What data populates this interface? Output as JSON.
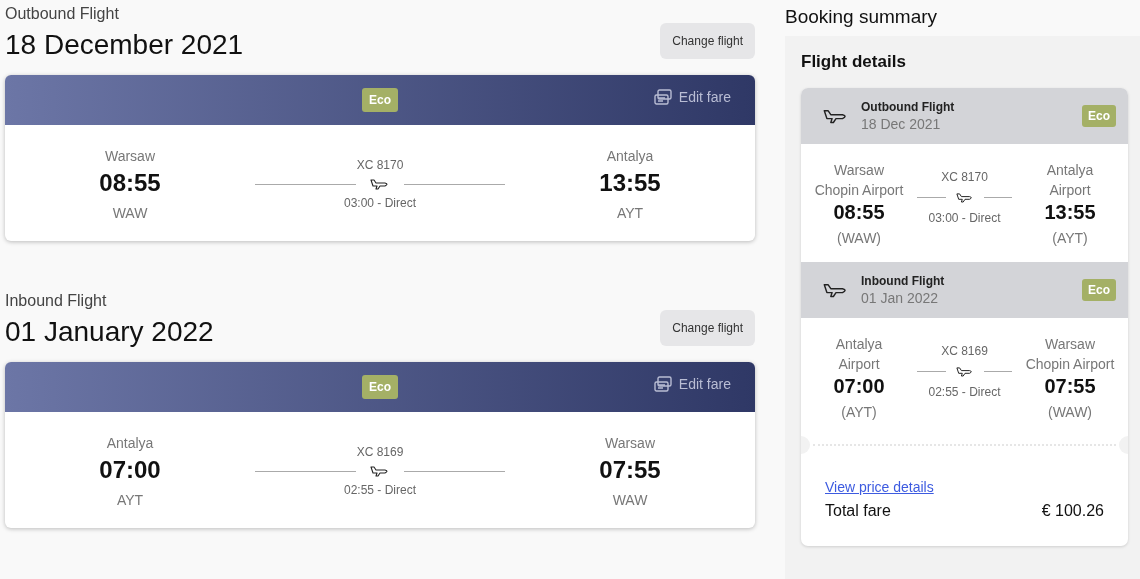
{
  "flights": [
    {
      "label": "Outbound Flight",
      "date": "18 December 2021",
      "change_button": "Change flight",
      "fare_badge": "Eco",
      "edit_fare": "Edit fare",
      "origin": {
        "city": "Warsaw",
        "time": "08:55",
        "code": "WAW"
      },
      "flight_number": "XC 8170",
      "duration": "03:00 - Direct",
      "destination": {
        "city": "Antalya",
        "time": "13:55",
        "code": "AYT"
      }
    },
    {
      "label": "Inbound Flight",
      "date": "01 January 2022",
      "change_button": "Change flight",
      "fare_badge": "Eco",
      "edit_fare": "Edit fare",
      "origin": {
        "city": "Antalya",
        "time": "07:00",
        "code": "AYT"
      },
      "flight_number": "XC 8169",
      "duration": "02:55 - Direct",
      "destination": {
        "city": "Warsaw",
        "time": "07:55",
        "code": "WAW"
      }
    }
  ],
  "summary": {
    "title": "Booking summary",
    "heading": "Flight details",
    "legs": [
      {
        "label": "Outbound Flight",
        "date": "18 Dec 2021",
        "badge": "Eco",
        "origin": {
          "airport": [
            "Warsaw",
            "Chopin Airport"
          ],
          "time": "08:55",
          "code": "(WAW)"
        },
        "flight_number": "XC 8170",
        "duration": "03:00 - Direct",
        "destination": {
          "airport": [
            "Antalya",
            "Airport"
          ],
          "time": "13:55",
          "code": "(AYT)"
        }
      },
      {
        "label": "Inbound Flight",
        "date": "01 Jan 2022",
        "badge": "Eco",
        "origin": {
          "airport": [
            "Antalya",
            "Airport"
          ],
          "time": "07:00",
          "code": "(AYT)"
        },
        "flight_number": "XC 8169",
        "duration": "02:55 - Direct",
        "destination": {
          "airport": [
            "Warsaw",
            "Chopin Airport"
          ],
          "time": "07:55",
          "code": "(WAW)"
        }
      }
    ],
    "price_link": "View price details",
    "total_label": "Total fare",
    "total": "€ 100.26"
  }
}
